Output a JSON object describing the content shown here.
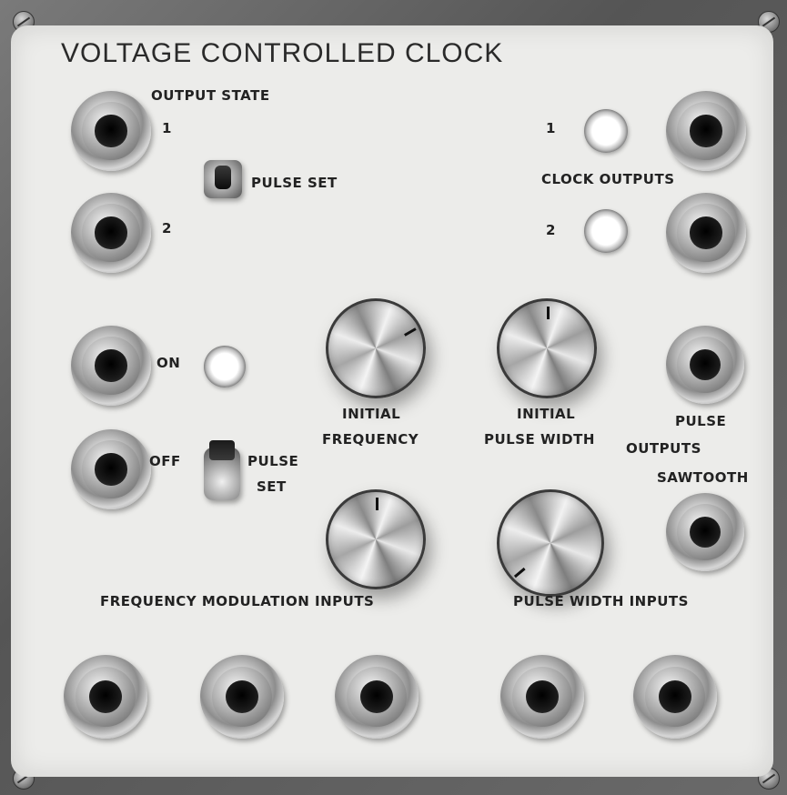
{
  "panel": {
    "title": "VOLTAGE CONTROLLED CLOCK",
    "output_state": {
      "heading": "OUTPUT STATE",
      "jack1_label": "1",
      "jack2_label": "2",
      "pulse_set_label": "PULSE SET"
    },
    "clock_outputs": {
      "heading": "CLOCK OUTPUTS",
      "lamp1_label": "1",
      "lamp2_label": "2"
    },
    "manual": {
      "on_label": "ON",
      "off_label": "OFF",
      "pulse_label": "PULSE",
      "set_label": "SET"
    },
    "knobs": {
      "initial_frequency_line1": "INITIAL",
      "initial_frequency_line2": "FREQUENCY",
      "initial_pulse_width_line1": "INITIAL",
      "initial_pulse_width_line2": "PULSE WIDTH"
    },
    "right_outputs": {
      "pulse_label": "PULSE",
      "outputs_label": "OUTPUTS",
      "sawtooth_label": "SAWTOOTH"
    },
    "inputs": {
      "frequency_modulation_label": "FREQUENCY MODULATION INPUTS",
      "pulse_width_label": "PULSE WIDTH INPUTS"
    }
  }
}
